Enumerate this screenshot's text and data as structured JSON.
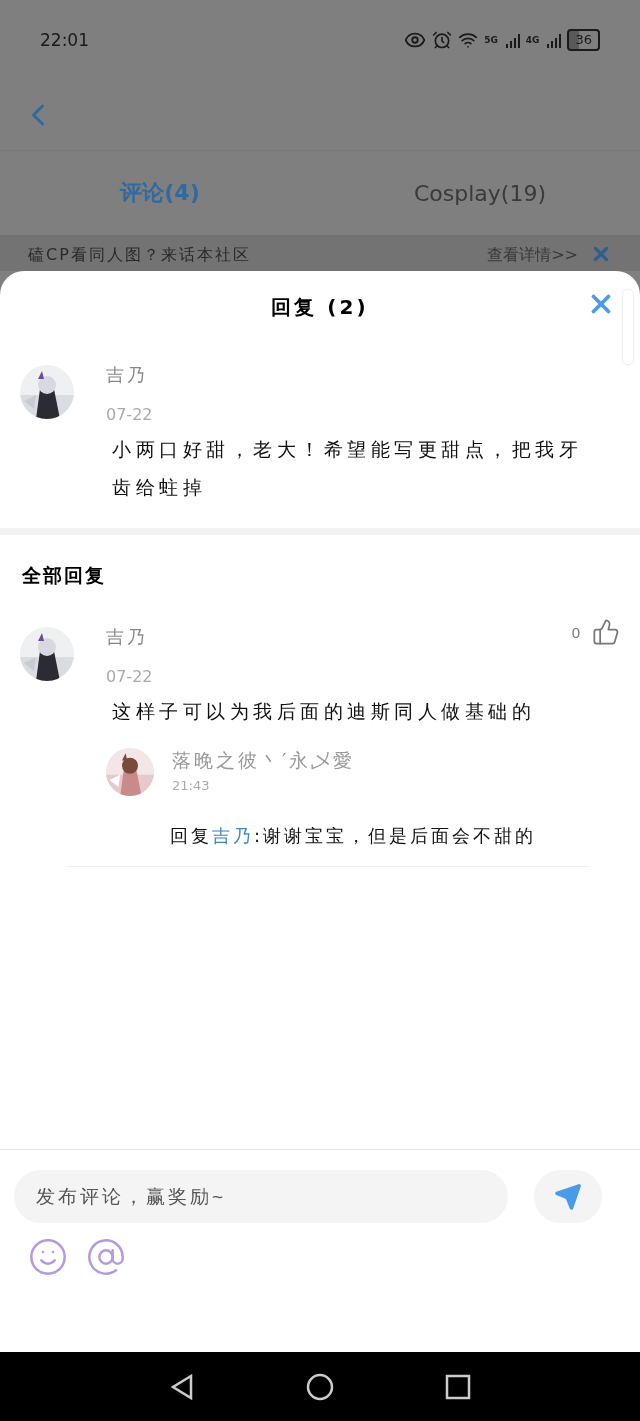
{
  "status_bar": {
    "time": "22:01",
    "network_1": "5G",
    "network_2": "4G",
    "battery": "36"
  },
  "tabs": [
    {
      "label": "评论(4)",
      "selected": true
    },
    {
      "label": "Cosplay(19)",
      "selected": false
    }
  ],
  "banner": {
    "text": "磕CP看同人图？来话本社区",
    "link": "查看详情>>"
  },
  "sheet": {
    "title": "回复 (2)",
    "comment": {
      "author": "吉乃",
      "date": "07-22",
      "text": "小两口好甜，老大！希望能写更甜点，把我牙齿给蛀掉"
    },
    "section_title": "全部回复",
    "replies": [
      {
        "author": "吉乃",
        "date": "07-22",
        "likes": "0",
        "text": "这样子可以为我后面的迪斯同人做基础的",
        "sub_replies": [
          {
            "author": "落晚之彼丶′永乄愛",
            "time": "21:43",
            "prefix": "回复",
            "target": "吉乃",
            "text": ":谢谢宝宝，但是后面会不甜的"
          }
        ]
      }
    ]
  },
  "composer": {
    "placeholder": "发布评论，赢奖励~"
  }
}
